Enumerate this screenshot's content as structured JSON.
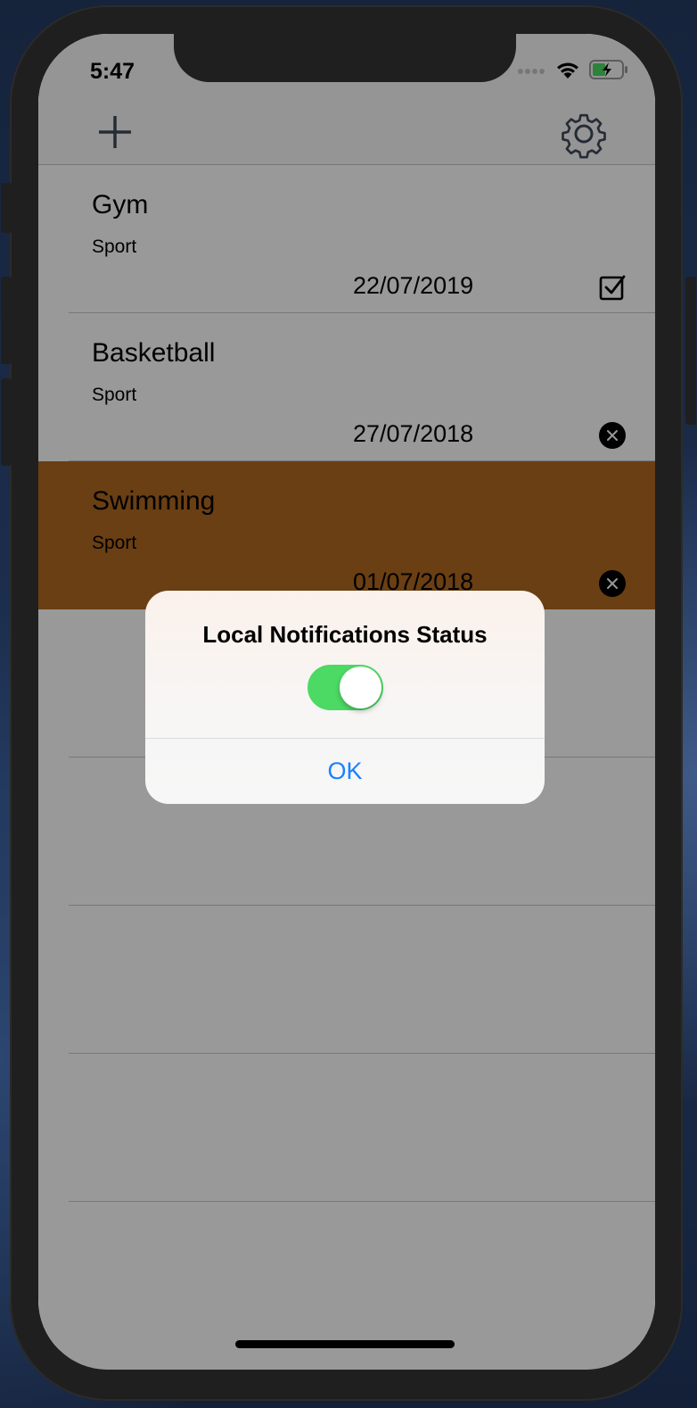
{
  "status_bar": {
    "time": "5:47",
    "icons": [
      "signal-dots-icon",
      "wifi-icon",
      "battery-charging-icon"
    ]
  },
  "navbar": {
    "left_icon": "plus-icon",
    "right_icon": "gear-icon"
  },
  "tasks": [
    {
      "title": "Gym",
      "category": "Sport",
      "date": "22/07/2019",
      "status_icon": "checkbox-checked-icon",
      "highlighted": false
    },
    {
      "title": "Basketball",
      "category": "Sport",
      "date": "27/07/2018",
      "status_icon": "close-circle-icon",
      "highlighted": false
    },
    {
      "title": "Swimming",
      "category": "Sport",
      "date": "01/07/2018",
      "status_icon": "close-circle-icon",
      "highlighted": true
    }
  ],
  "alert": {
    "title": "Local Notifications Status",
    "toggle_on": true,
    "ok_label": "OK"
  },
  "colors": {
    "toggle_on": "#4cd964",
    "ok_text": "#1a82fb",
    "highlight_row": "#b16a21"
  }
}
